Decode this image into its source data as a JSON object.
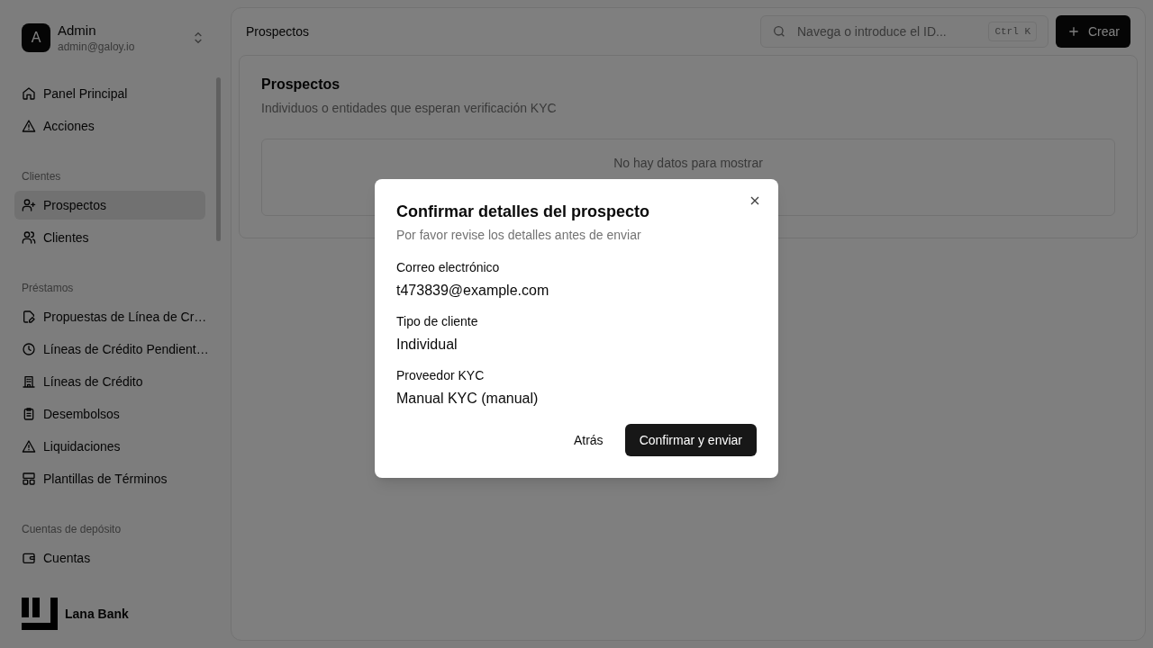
{
  "user": {
    "initial": "A",
    "name": "Admin",
    "email": "admin@galoy.io"
  },
  "sidebar": {
    "sections": [
      {
        "items": [
          {
            "label": "Panel Principal",
            "selected": false
          },
          {
            "label": "Acciones",
            "selected": false
          }
        ]
      },
      {
        "title": "Clientes",
        "items": [
          {
            "label": "Prospectos",
            "selected": true
          },
          {
            "label": "Clientes",
            "selected": false
          }
        ]
      },
      {
        "title": "Préstamos",
        "items": [
          {
            "label": "Propuestas de Línea de Cr…",
            "selected": false
          },
          {
            "label": "Líneas de Crédito Pendient…",
            "selected": false
          },
          {
            "label": "Líneas de Crédito",
            "selected": false
          },
          {
            "label": "Desembolsos",
            "selected": false
          },
          {
            "label": "Liquidaciones",
            "selected": false
          },
          {
            "label": "Plantillas de Términos",
            "selected": false
          }
        ]
      },
      {
        "title": "Cuentas de depósito",
        "items": [
          {
            "label": "Cuentas",
            "selected": false
          }
        ]
      }
    ]
  },
  "brand": "Lana Bank",
  "header": {
    "breadcrumb": "Prospectos",
    "search": {
      "placeholder": "Navega o introduce el ID...",
      "shortcut": "Ctrl K"
    },
    "create_button": "Crear"
  },
  "card": {
    "title": "Prospectos",
    "subtitle": "Individuos o entidades que esperan verificación KYC",
    "empty": "No hay datos para mostrar"
  },
  "dialog": {
    "title": "Confirmar detalles del prospecto",
    "subtitle": "Por favor revise los detalles antes de enviar",
    "fields": [
      {
        "label": "Correo electrónico",
        "value": "t473839@example.com"
      },
      {
        "label": "Tipo de cliente",
        "value": "Individual"
      },
      {
        "label": "Proveedor KYC",
        "value": "Manual KYC (manual)"
      }
    ],
    "back_button": "Atrás",
    "confirm_button": "Confirmar y enviar"
  }
}
